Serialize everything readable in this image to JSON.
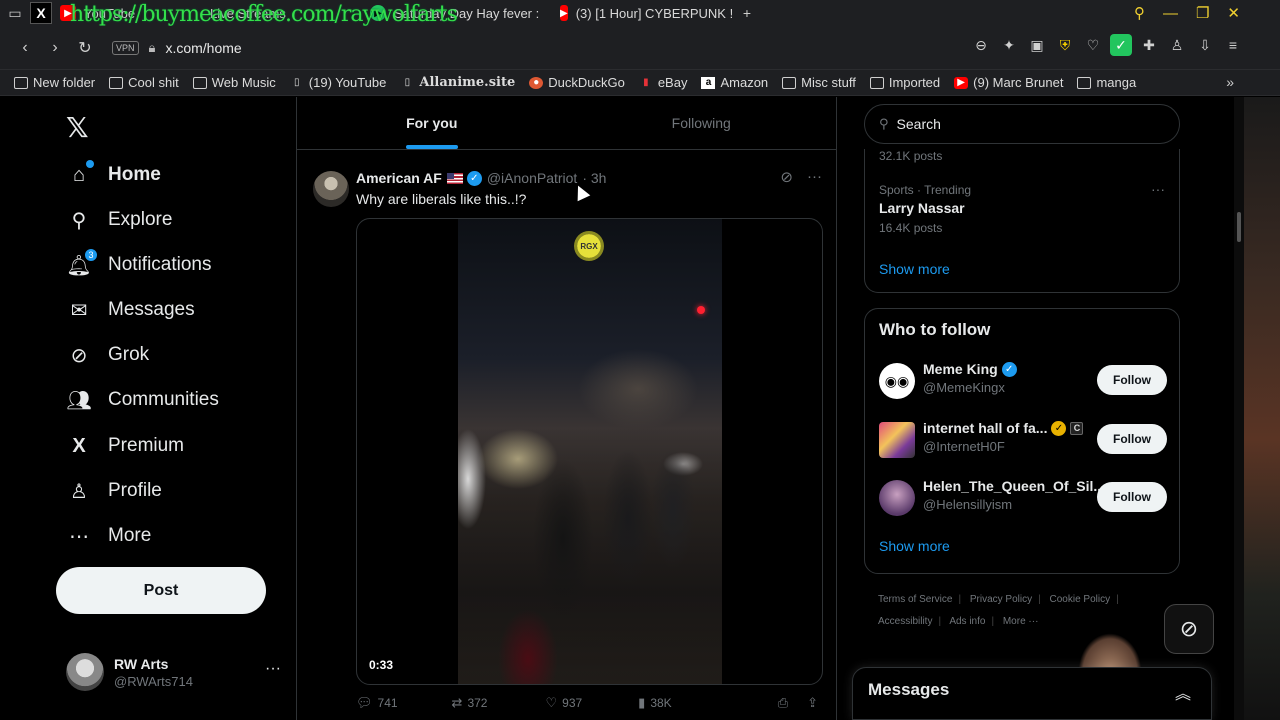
{
  "browser": {
    "tabs": [
      {
        "label": "YouTube",
        "fav_color": "#ff0000"
      },
      {
        "label": "Live Streams",
        "fav_color": "#555555"
      },
      {
        "label": "Saturday Day Hay fever :",
        "fav_color": "#22c55e"
      },
      {
        "label": "(3) [1 Hour] CYBERPUNK !",
        "fav_color": "#ff0000"
      }
    ],
    "overlay_text": "https://buymeacoffee.com/raywolfarts",
    "vpn_label": "VPN",
    "url": "x.com/home",
    "bookmarks": [
      {
        "label": "New folder",
        "type": "folder"
      },
      {
        "label": "Cool shit",
        "type": "folder"
      },
      {
        "label": "Web Music",
        "type": "folder"
      },
      {
        "label": "(19) YouTube",
        "type": "page"
      },
      {
        "label": "Allanime.site",
        "type": "page"
      },
      {
        "label": "DuckDuckGo",
        "type": "site"
      },
      {
        "label": "eBay",
        "type": "site"
      },
      {
        "label": "Amazon",
        "type": "site"
      },
      {
        "label": "Misc stuff",
        "type": "folder"
      },
      {
        "label": "Imported",
        "type": "folder"
      },
      {
        "label": "(9) Marc Brunet",
        "type": "site"
      },
      {
        "label": "manga",
        "type": "folder"
      }
    ]
  },
  "nav": {
    "items": [
      {
        "label": "Home",
        "icon": "home-icon",
        "glyph": "⌂"
      },
      {
        "label": "Explore",
        "icon": "search-icon",
        "glyph": "⚲"
      },
      {
        "label": "Notifications",
        "icon": "bell-icon",
        "glyph": "🔔︎",
        "badge": "3"
      },
      {
        "label": "Messages",
        "icon": "envelope-icon",
        "glyph": "✉"
      },
      {
        "label": "Grok",
        "icon": "grok-icon",
        "glyph": "⊘"
      },
      {
        "label": "Communities",
        "icon": "communities-icon",
        "glyph": "👥︎"
      },
      {
        "label": "Premium",
        "icon": "x-premium-icon",
        "glyph": "X"
      },
      {
        "label": "Profile",
        "icon": "person-icon",
        "glyph": "♙"
      },
      {
        "label": "More",
        "icon": "more-circle-icon",
        "glyph": "⋯"
      }
    ],
    "post_label": "Post",
    "account": {
      "name": "RW Arts",
      "handle": "@RWArts714"
    }
  },
  "timeline": {
    "tabs": [
      "For you",
      "Following"
    ],
    "tweet": {
      "name": "American AF",
      "handle": "@iAnonPatriot",
      "time": "· 3h",
      "text": "Why are liberals like this..!?",
      "media_badge": "RGX",
      "duration": "0:33",
      "replies": "741",
      "reposts": "372",
      "likes": "937",
      "views": "38K"
    }
  },
  "sidebar": {
    "search_placeholder": "Search",
    "trend_prev_posts": "32.1K posts",
    "trend": {
      "category": "Sports · Trending",
      "name": "Larry Nassar",
      "posts": "16.4K posts"
    },
    "show_more": "Show more",
    "who_to_follow_title": "Who to follow",
    "follow_label": "Follow",
    "suggestions": [
      {
        "name": "Meme King",
        "handle": "@MemeKingx",
        "verified": "blue"
      },
      {
        "name": "internet hall of fa...",
        "handle": "@InternetH0F",
        "verified": "gold",
        "affiliate": "C"
      },
      {
        "name": "Helen_The_Queen_Of_Sil...",
        "handle": "@Helensillyism",
        "verified": "none"
      }
    ],
    "footer": [
      "Terms of Service",
      "Privacy Policy",
      "Cookie Policy",
      "Accessibility",
      "Ads info",
      "More ···"
    ],
    "messages_title": "Messages"
  },
  "colors": {
    "accent": "#1d9bf0",
    "background": "#000000",
    "text": "#e7e9ea",
    "muted": "#71767b"
  }
}
